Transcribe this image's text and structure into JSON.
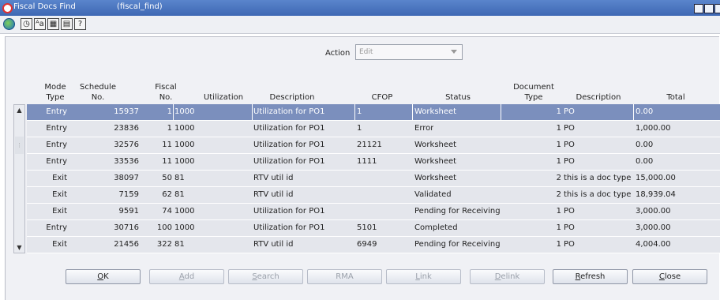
{
  "window": {
    "title": "Fiscal Docs Find",
    "subtitle": "(fiscal_find)"
  },
  "toolbar": {
    "icons": [
      "globe-icon",
      "clock-icon",
      "font-icon",
      "grid-icon",
      "print-icon",
      "help-icon"
    ],
    "icon_glyphs": [
      "",
      "◷",
      "ᴬa",
      "▦",
      "▤",
      "?"
    ]
  },
  "action": {
    "label": "Action",
    "value": "Edit"
  },
  "columns": {
    "mode_type": "Mode\nType",
    "schedule_no": "Schedule\nNo.",
    "fiscal_no": "Fiscal\nNo.",
    "utilization": "Utilization",
    "description": "Description",
    "cfop": "CFOP",
    "status": "Status",
    "document_type": "Document\nType",
    "doc_description": "Description",
    "total": "Total"
  },
  "rows": [
    {
      "mode": "Entry",
      "schedule": "15937",
      "fiscal": "1",
      "util": "1000",
      "desc": "Utilization for PO1",
      "cfop": "1",
      "status": "Worksheet",
      "doctype": "1",
      "docdesc": "PO",
      "total": "0.00",
      "selected": true
    },
    {
      "mode": "Entry",
      "schedule": "23836",
      "fiscal": "1",
      "util": "1000",
      "desc": "Utilization for PO1",
      "cfop": "1",
      "status": "Error",
      "doctype": "1",
      "docdesc": "PO",
      "total": "1,000.00"
    },
    {
      "mode": "Entry",
      "schedule": "32576",
      "fiscal": "11",
      "util": "1000",
      "desc": "Utilization for PO1",
      "cfop": "21121",
      "status": "Worksheet",
      "doctype": "1",
      "docdesc": "PO",
      "total": "0.00"
    },
    {
      "mode": "Entry",
      "schedule": "33536",
      "fiscal": "11",
      "util": "1000",
      "desc": "Utilization for PO1",
      "cfop": "1111",
      "status": "Worksheet",
      "doctype": "1",
      "docdesc": "PO",
      "total": "0.00"
    },
    {
      "mode": "Exit",
      "schedule": "38097",
      "fiscal": "50",
      "util": "81",
      "desc": "RTV util id",
      "cfop": "",
      "status": "Worksheet",
      "doctype": "2",
      "docdesc": "this is a doc type ic",
      "total": "15,000.00"
    },
    {
      "mode": "Exit",
      "schedule": "7159",
      "fiscal": "62",
      "util": "81",
      "desc": "RTV util id",
      "cfop": "",
      "status": "Validated",
      "doctype": "2",
      "docdesc": "this is a doc type ic",
      "total": "18,939.04"
    },
    {
      "mode": "Exit",
      "schedule": "9591",
      "fiscal": "74",
      "util": "1000",
      "desc": "Utilization for PO1",
      "cfop": "",
      "status": "Pending for Receiving",
      "doctype": "1",
      "docdesc": "PO",
      "total": "3,000.00"
    },
    {
      "mode": "Entry",
      "schedule": "30716",
      "fiscal": "100",
      "util": "1000",
      "desc": "Utilization for PO1",
      "cfop": "5101",
      "status": "Completed",
      "doctype": "1",
      "docdesc": "PO",
      "total": "3,000.00"
    },
    {
      "mode": "Exit",
      "schedule": "21456",
      "fiscal": "322",
      "util": "81",
      "desc": "RTV util id",
      "cfop": "6949",
      "status": "Pending for Receiving",
      "doctype": "1",
      "docdesc": "PO",
      "total": "4,004.00"
    }
  ],
  "buttons": [
    {
      "id": "ok",
      "label": "OK",
      "mnemonic": "O",
      "rest": "K",
      "enabled": true
    },
    {
      "id": "add",
      "label": "Add",
      "mnemonic": "A",
      "rest": "dd",
      "enabled": false
    },
    {
      "id": "search",
      "label": "Search",
      "mnemonic": "S",
      "rest": "earch",
      "enabled": false
    },
    {
      "id": "rma",
      "label": "RMA",
      "mnemonic": "",
      "rest": "RMA",
      "enabled": false
    },
    {
      "id": "link",
      "label": "Link",
      "mnemonic": "L",
      "rest": "ink",
      "enabled": false
    },
    {
      "id": "delink",
      "label": "Delink",
      "mnemonic": "D",
      "rest": "elink",
      "enabled": false
    },
    {
      "id": "refresh",
      "label": "Refresh",
      "mnemonic": "R",
      "rest": "efresh",
      "enabled": true
    },
    {
      "id": "close",
      "label": "Close",
      "mnemonic": "C",
      "rest": "lose",
      "enabled": true
    }
  ],
  "colors": {
    "titlebar": "#3e68b3",
    "selected_row": "#7b8fbd",
    "row": "#e4e6ec"
  }
}
